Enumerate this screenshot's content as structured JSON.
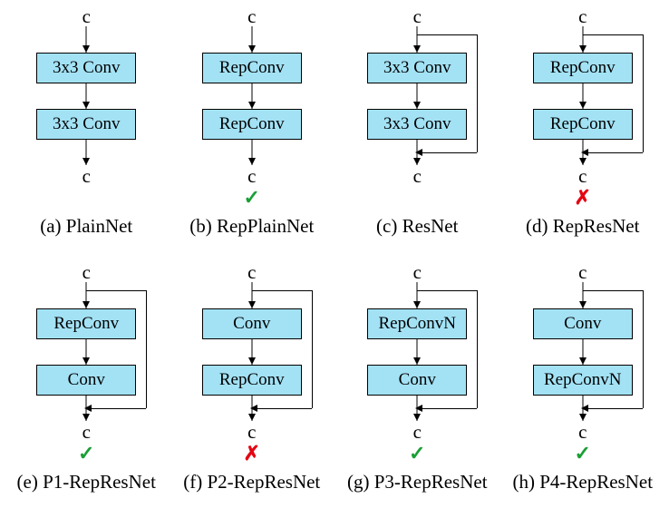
{
  "labels": {
    "input": "c",
    "output": "c"
  },
  "marks": {
    "check": "✓",
    "cross": "✗"
  },
  "cells": [
    {
      "id": "a",
      "caption": "(a) PlainNet",
      "block1": "3x3 Conv",
      "block2": "3x3 Conv",
      "skip": false,
      "mark": null
    },
    {
      "id": "b",
      "caption": "(b) RepPlainNet",
      "block1": "RepConv",
      "block2": "RepConv",
      "skip": false,
      "mark": "check"
    },
    {
      "id": "c",
      "caption": "(c) ResNet",
      "block1": "3x3 Conv",
      "block2": "3x3 Conv",
      "skip": true,
      "mark": null
    },
    {
      "id": "d",
      "caption": "(d) RepResNet",
      "block1": "RepConv",
      "block2": "RepConv",
      "skip": true,
      "mark": "cross"
    },
    {
      "id": "e",
      "caption": "(e) P1-RepResNet",
      "block1": "RepConv",
      "block2": "Conv",
      "skip": true,
      "mark": "check"
    },
    {
      "id": "f",
      "caption": "(f) P2-RepResNet",
      "block1": "Conv",
      "block2": "RepConv",
      "skip": true,
      "mark": "cross"
    },
    {
      "id": "g",
      "caption": "(g) P3-RepResNet",
      "block1": "RepConvN",
      "block2": "Conv",
      "skip": true,
      "mark": "check"
    },
    {
      "id": "h",
      "caption": "(h) P4-RepResNet",
      "block1": "Conv",
      "block2": "RepConvN",
      "skip": true,
      "mark": "check"
    }
  ]
}
